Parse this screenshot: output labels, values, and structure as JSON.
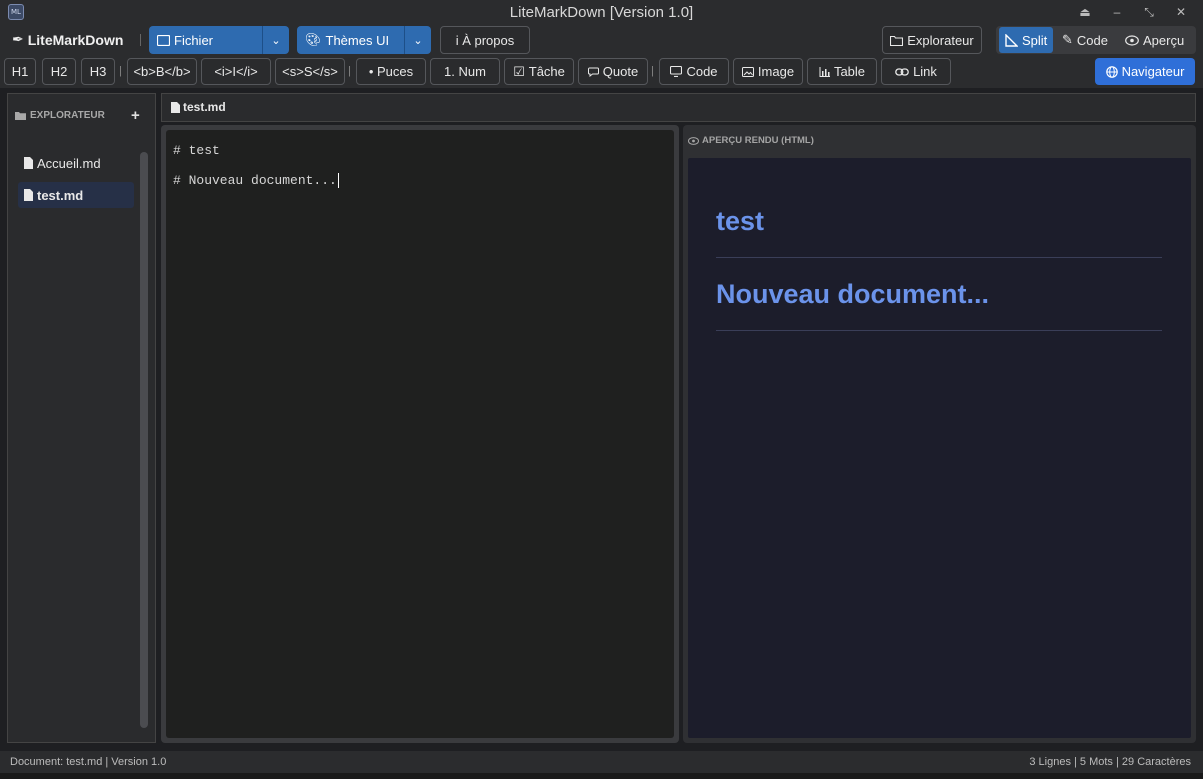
{
  "window": {
    "title": "LiteMarkDown [Version 1.0]",
    "icon_text": "ML"
  },
  "topbar": {
    "brand": "LiteMarkDown",
    "fichier_label": "Fichier",
    "themes_label": "Thèmes UI",
    "about_label": "i À propos",
    "explorer_label": "Explorateur",
    "view_split": "Split",
    "view_code": "Code",
    "view_preview": "Aperçu",
    "active_view": "Split"
  },
  "format_toolbar": {
    "h1": "H1",
    "h2": "H2",
    "h3": "H3",
    "bold": "<b>B</b>",
    "italic": "<i>I</i>",
    "strike": "<s>S</s>",
    "bullets": "• Puces",
    "numbered": "1. Num",
    "task": "Tâche",
    "quote": "Quote",
    "code": "Code",
    "image": "Image",
    "table": "Table",
    "link": "Link",
    "navigator": "Navigateur"
  },
  "sidebar": {
    "header": "EXPLORATEUR",
    "add": "+",
    "files": [
      {
        "name": "Accueil.md",
        "selected": false
      },
      {
        "name": "test.md",
        "selected": true
      }
    ]
  },
  "tab": {
    "name": "test.md"
  },
  "editor": {
    "lines": [
      "# test",
      "# Nouveau document..."
    ]
  },
  "preview": {
    "header": "APERÇU RENDU (HTML)",
    "headings": [
      "test",
      "Nouveau document..."
    ]
  },
  "statusbar": {
    "left": "Document: test.md | Version 1.0",
    "right": "3 Lignes | 5 Mots | 29 Caractères"
  },
  "colors": {
    "accent": "#2e6bb0",
    "navigator": "#2f6fd8",
    "preview_heading": "#6b93ea"
  }
}
